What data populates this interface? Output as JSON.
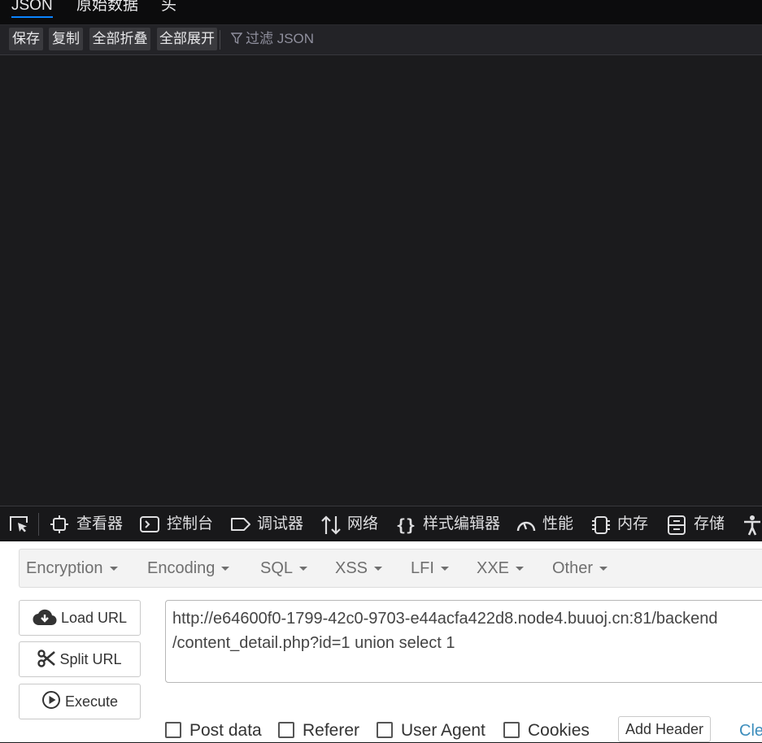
{
  "json_viewer": {
    "tabs": [
      {
        "label": "JSON",
        "active": true
      },
      {
        "label": "原始数据",
        "active": false
      },
      {
        "label": "头",
        "active": false
      }
    ],
    "toolbar": {
      "save": "保存",
      "copy": "复制",
      "collapse_all": "全部折叠",
      "expand_all": "全部展开",
      "filter_placeholder": "过滤 JSON"
    }
  },
  "devtools": {
    "tools": [
      {
        "label": "查看器",
        "icon": "inspector-icon"
      },
      {
        "label": "控制台",
        "icon": "console-icon"
      },
      {
        "label": "调试器",
        "icon": "debugger-icon"
      },
      {
        "label": "网络",
        "icon": "network-icon"
      },
      {
        "label": "样式编辑器",
        "icon": "style-editor-icon"
      },
      {
        "label": "性能",
        "icon": "performance-icon"
      },
      {
        "label": "内存",
        "icon": "memory-icon"
      },
      {
        "label": "存储",
        "icon": "storage-icon"
      }
    ]
  },
  "hackbar": {
    "menus": [
      "Encryption",
      "Encoding",
      "SQL",
      "XSS",
      "LFI",
      "XXE",
      "Other"
    ],
    "buttons": {
      "load_url": "Load URL",
      "split_url": "Split URL",
      "execute": "Execute"
    },
    "url_value": "http://e64600f0-1799-42c0-9703-e44acfa422d8.node4.buuoj.cn:81/backend\n/content_detail.php?id=1 union select 1",
    "options": {
      "post_data": "Post data",
      "referer": "Referer",
      "user_agent": "User Agent",
      "cookies": "Cookies"
    },
    "add_header": "Add Header",
    "clear_all": "Clear All"
  },
  "colors": {
    "devtools_bg": "#1b1b1d",
    "accent": "#0a84ff",
    "link": "#3c8dbc"
  }
}
